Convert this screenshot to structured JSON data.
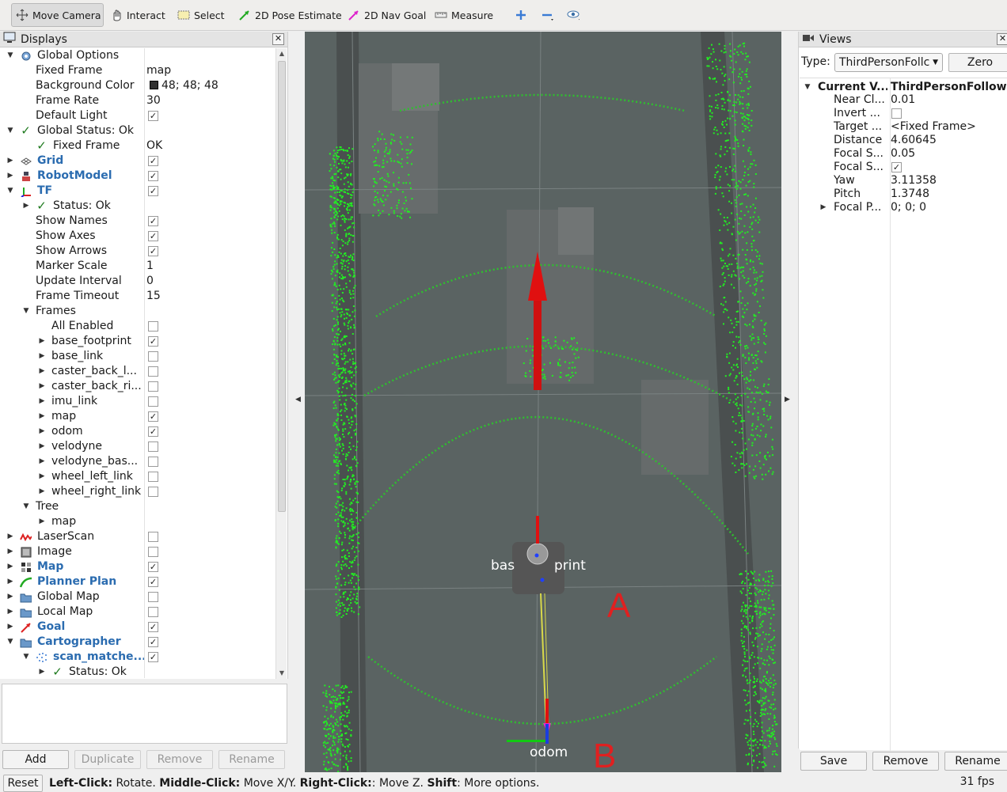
{
  "toolbar": {
    "items": [
      {
        "label": "Move Camera",
        "icon": "move-camera-icon"
      },
      {
        "label": "Interact",
        "icon": "interact-icon"
      },
      {
        "label": "Select",
        "icon": "select-icon"
      },
      {
        "label": "2D Pose Estimate",
        "icon": "pose-estimate-icon"
      },
      {
        "label": "2D Nav Goal",
        "icon": "nav-goal-icon"
      },
      {
        "label": "Measure",
        "icon": "measure-icon"
      }
    ]
  },
  "displays": {
    "title": "Displays",
    "rows": [
      {
        "label": "Global Options",
        "indent": 0,
        "expand": "down",
        "icon": "gear-icon"
      },
      {
        "label": "Fixed Frame",
        "indent": 1,
        "value": "map"
      },
      {
        "label": "Background Color",
        "indent": 1,
        "value": "48; 48; 48",
        "swatch": true
      },
      {
        "label": "Frame Rate",
        "indent": 1,
        "value": "30"
      },
      {
        "label": "Default Light",
        "indent": 1,
        "check": true
      },
      {
        "label": "Global Status: Ok",
        "indent": 0,
        "expand": "down",
        "icon": "ok-check-icon"
      },
      {
        "label": "Fixed Frame",
        "indent": 1,
        "value": "OK",
        "icon": "ok-check-icon"
      },
      {
        "label": "Grid",
        "indent": 0,
        "expand": "right",
        "icon": "grid-icon",
        "blue": true,
        "check": true
      },
      {
        "label": "RobotModel",
        "indent": 0,
        "expand": "right",
        "icon": "robot-icon",
        "blue": true,
        "check": true
      },
      {
        "label": "TF",
        "indent": 0,
        "expand": "down",
        "icon": "axes-icon",
        "blue": true,
        "check": true
      },
      {
        "label": "Status: Ok",
        "indent": 1,
        "expand": "right",
        "icon": "ok-check-icon"
      },
      {
        "label": "Show Names",
        "indent": 1,
        "check": true
      },
      {
        "label": "Show Axes",
        "indent": 1,
        "check": true
      },
      {
        "label": "Show Arrows",
        "indent": 1,
        "check": true
      },
      {
        "label": "Marker Scale",
        "indent": 1,
        "value": "1"
      },
      {
        "label": "Update Interval",
        "indent": 1,
        "value": "0"
      },
      {
        "label": "Frame Timeout",
        "indent": 1,
        "value": "15"
      },
      {
        "label": "Frames",
        "indent": 1,
        "expand": "down"
      },
      {
        "label": "All Enabled",
        "indent": 2,
        "check": false
      },
      {
        "label": "base_footprint",
        "indent": 2,
        "expand": "right",
        "check": true
      },
      {
        "label": "base_link",
        "indent": 2,
        "expand": "right",
        "check": false
      },
      {
        "label": "caster_back_l...",
        "indent": 2,
        "expand": "right",
        "check": false
      },
      {
        "label": "caster_back_ri...",
        "indent": 2,
        "expand": "right",
        "check": false
      },
      {
        "label": "imu_link",
        "indent": 2,
        "expand": "right",
        "check": false
      },
      {
        "label": "map",
        "indent": 2,
        "expand": "right",
        "check": true
      },
      {
        "label": "odom",
        "indent": 2,
        "expand": "right",
        "check": true
      },
      {
        "label": "velodyne",
        "indent": 2,
        "expand": "right",
        "check": false
      },
      {
        "label": "velodyne_bas...",
        "indent": 2,
        "expand": "right",
        "check": false
      },
      {
        "label": "wheel_left_link",
        "indent": 2,
        "expand": "right",
        "check": false
      },
      {
        "label": "wheel_right_link",
        "indent": 2,
        "expand": "right",
        "check": false
      },
      {
        "label": "Tree",
        "indent": 1,
        "expand": "down"
      },
      {
        "label": "map",
        "indent": 2,
        "expand": "right"
      },
      {
        "label": "LaserScan",
        "indent": 0,
        "expand": "right",
        "icon": "laserscan-icon",
        "check": false
      },
      {
        "label": "Image",
        "indent": 0,
        "expand": "right",
        "icon": "image-icon",
        "check": false
      },
      {
        "label": "Map",
        "indent": 0,
        "expand": "right",
        "icon": "map-icon",
        "blue": true,
        "check": true
      },
      {
        "label": "Planner Plan",
        "indent": 0,
        "expand": "right",
        "icon": "path-icon",
        "blue": true,
        "check": true
      },
      {
        "label": "Global Map",
        "indent": 0,
        "expand": "right",
        "icon": "folder-icon",
        "check": false
      },
      {
        "label": "Local Map",
        "indent": 0,
        "expand": "right",
        "icon": "folder-icon",
        "check": false
      },
      {
        "label": "Goal",
        "indent": 0,
        "expand": "right",
        "icon": "goal-icon",
        "blue": true,
        "check": true
      },
      {
        "label": "Cartographer",
        "indent": 0,
        "expand": "down",
        "icon": "folder-icon",
        "blue": true,
        "check": true
      },
      {
        "label": "scan_matche...",
        "indent": 1,
        "expand": "down",
        "icon": "pointcloud-icon",
        "blue": true,
        "check": true
      },
      {
        "label": "Status: Ok",
        "indent": 2,
        "expand": "right",
        "icon": "ok-check-icon"
      }
    ],
    "buttons": {
      "add": "Add",
      "duplicate": "Duplicate",
      "remove": "Remove",
      "rename": "Rename"
    }
  },
  "viewport": {
    "robot_label": "base_footprint",
    "robot_label_visible": "bas",
    "robot_label_visible_2": "print",
    "odom_label": "odom",
    "annotation_a": "A",
    "annotation_b": "B",
    "colors": {
      "background": "#5a6362",
      "scan": "#22ee22",
      "arrow": "#e01010",
      "annotation": "#e02020"
    }
  },
  "views": {
    "title": "Views",
    "type_label": "Type:",
    "type_value": "ThirdPersonFollc",
    "zero": "Zero",
    "header_name": "Current V...",
    "header_value": "ThirdPersonFollow...",
    "props": [
      {
        "label": "Near Cl...",
        "value": "0.01"
      },
      {
        "label": "Invert ...",
        "check": false
      },
      {
        "label": "Target ...",
        "value": "<Fixed Frame>"
      },
      {
        "label": "Distance",
        "value": "4.60645"
      },
      {
        "label": "Focal S...",
        "value": "0.05"
      },
      {
        "label": "Focal S...",
        "check": true
      },
      {
        "label": "Yaw",
        "value": "3.11358"
      },
      {
        "label": "Pitch",
        "value": "1.3748"
      },
      {
        "label": "Focal P...",
        "value": "0; 0; 0",
        "expand": true
      }
    ],
    "buttons": {
      "save": "Save",
      "remove": "Remove",
      "rename": "Rename"
    }
  },
  "statusbar": {
    "reset": "Reset",
    "h1": "Left-Click:",
    "t1": " Rotate. ",
    "h2": "Middle-Click:",
    "t2": " Move X/Y. ",
    "h3": "Right-Click:",
    "t3": ": Move Z. ",
    "h4": "Shift",
    "t4": ": More options.",
    "fps": "31 fps"
  }
}
